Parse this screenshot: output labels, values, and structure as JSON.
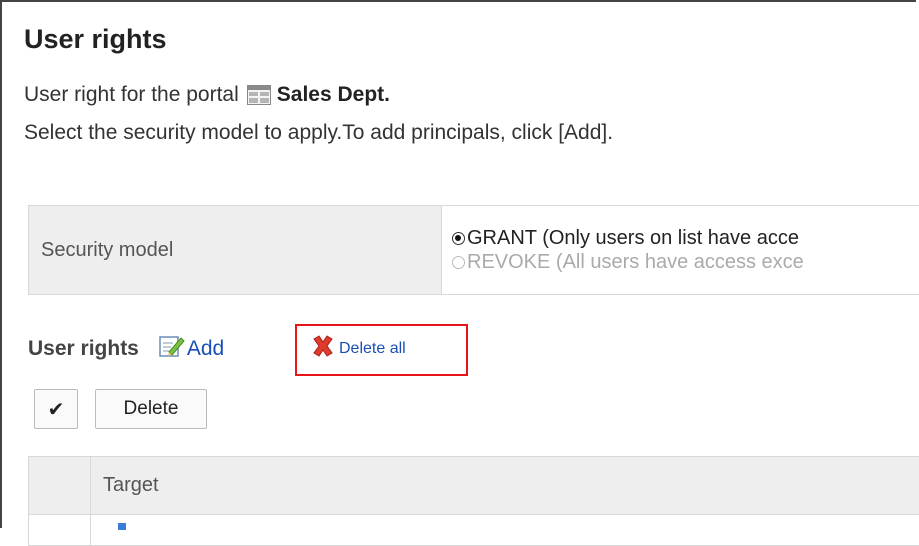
{
  "page": {
    "title": "User rights",
    "description_prefix": "User right for the portal",
    "portal_name": "Sales Dept.",
    "instruction": "Select the security model to apply.To add principals, click [Add]."
  },
  "security": {
    "label": "Security model",
    "options": [
      {
        "label": "GRANT (Only users on list have acce",
        "selected": true
      },
      {
        "label": "REVOKE (All users have access exce",
        "selected": false
      }
    ]
  },
  "rights": {
    "heading": "User rights",
    "add_label": "Add",
    "delete_all_label": "Delete all",
    "check_label": "✔",
    "delete_label": "Delete"
  },
  "table": {
    "headers": [
      "",
      "Target"
    ]
  },
  "icons": {
    "portal": "portal-icon",
    "add": "edit-pencil-icon",
    "delete_all": "red-x-icon"
  },
  "colors": {
    "link": "#1a4fb8",
    "highlight": "#e8141a",
    "header_bg": "#eeeeee"
  }
}
